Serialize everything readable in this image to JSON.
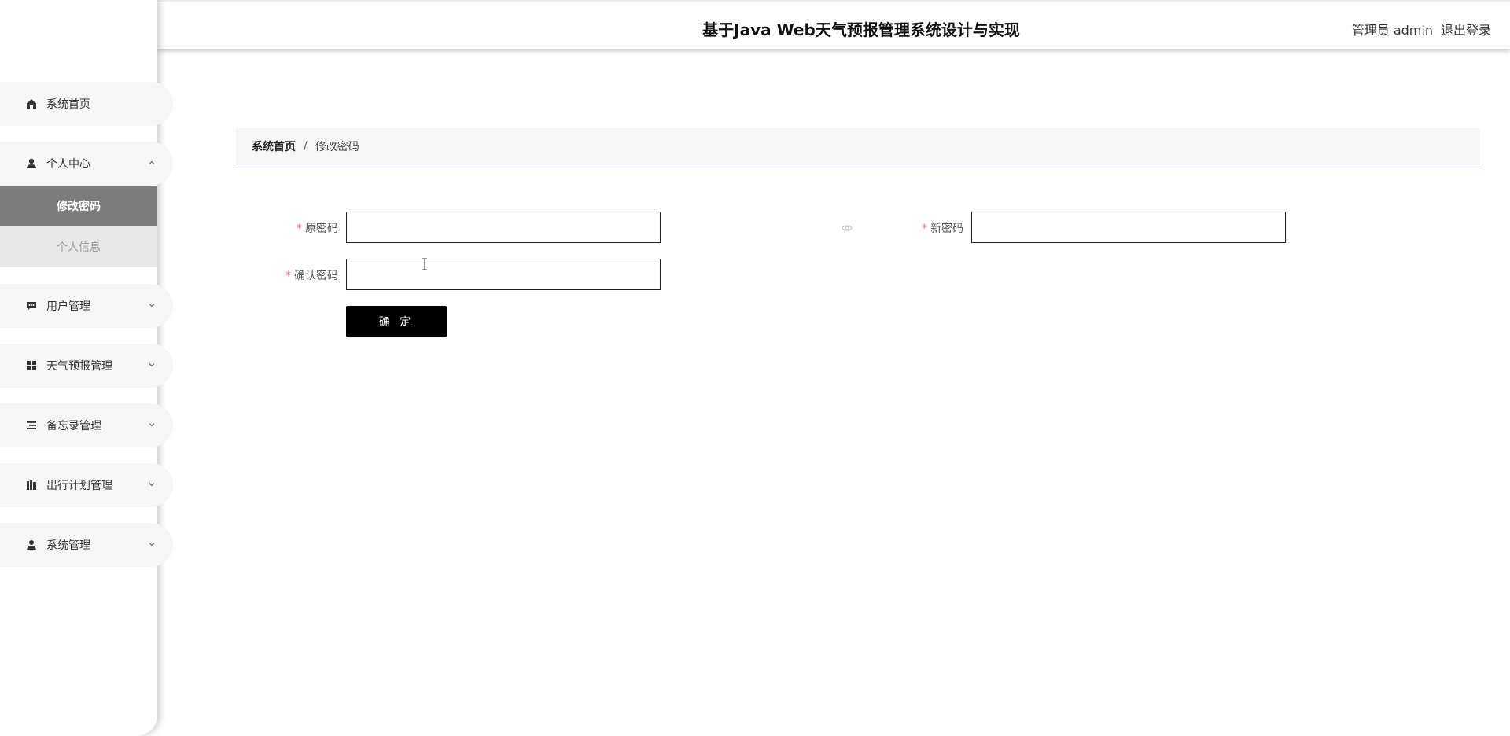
{
  "header": {
    "title": "基于Java Web天气预报管理系统设计与实现",
    "user_label": "管理员 admin",
    "logout_label": "退出登录"
  },
  "sidebar": {
    "items": [
      {
        "label": "系统首页",
        "icon": "home-icon"
      },
      {
        "label": "个人中心",
        "icon": "person-icon",
        "expanded": true
      },
      {
        "label": "用户管理",
        "icon": "chat-icon"
      },
      {
        "label": "天气预报管理",
        "icon": "grid-icon"
      },
      {
        "label": "备忘录管理",
        "icon": "list-icon"
      },
      {
        "label": "出行计划管理",
        "icon": "book-icon"
      },
      {
        "label": "系统管理",
        "icon": "user-icon"
      }
    ],
    "sub_items": [
      {
        "label": "修改密码",
        "active": true
      },
      {
        "label": "个人信息",
        "active": false
      }
    ]
  },
  "breadcrumb": {
    "home": "系统首页",
    "separator": "/",
    "current": "修改密码"
  },
  "form": {
    "required_mark": "*",
    "old_password_label": "原密码",
    "old_password_value": "",
    "new_password_label": "新密码",
    "new_password_value": "",
    "confirm_password_label": "确认密码",
    "confirm_password_value": "",
    "submit_label": "确 定"
  },
  "colors": {
    "accent": "#000000",
    "required": "#f56c6c",
    "active_sub_bg": "#7c7c7c",
    "breadcrumb_border": "#9b93c9"
  }
}
